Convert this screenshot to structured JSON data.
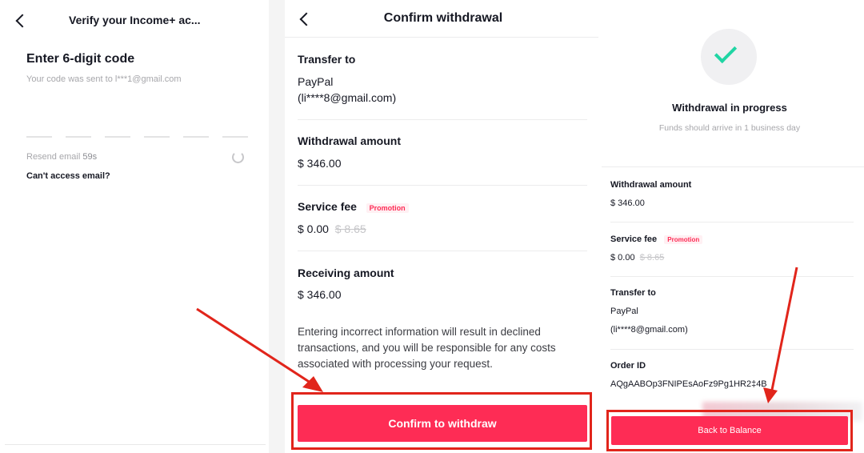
{
  "screen1": {
    "title": "Verify your Income+ ac...",
    "heading": "Enter 6-digit code",
    "subtext": "Your code was sent to l***1@gmail.com",
    "resend_label": "Resend email",
    "resend_timer": "59s",
    "cant_access": "Can't access email?"
  },
  "screen2": {
    "title": "Confirm withdrawal",
    "transfer_label": "Transfer to",
    "transfer_method": "PayPal",
    "transfer_email": "(li****8@gmail.com)",
    "withdrawal_label": "Withdrawal amount",
    "withdrawal_value": "$ 346.00",
    "fee_label": "Service fee",
    "promo_badge": "Promotion",
    "fee_value": "$ 0.00",
    "fee_original": "$ 8.65",
    "receiving_label": "Receiving amount",
    "receiving_value": "$ 346.00",
    "note": "Entering incorrect information will result in declined transactions, and you will be responsible for any costs associated with processing your request.",
    "confirm_button": "Confirm to withdraw"
  },
  "screen3": {
    "status_title": "Withdrawal in progress",
    "status_sub": "Funds should arrive in 1 business day",
    "withdrawal_label": "Withdrawal amount",
    "withdrawal_value": "$ 346.00",
    "fee_label": "Service fee",
    "promo_badge": "Promotion",
    "fee_value": "$ 0.00",
    "fee_original": "$ 8.65",
    "transfer_label": "Transfer to",
    "transfer_method": "PayPal",
    "transfer_email": "(li****8@gmail.com)",
    "order_label": "Order ID",
    "order_value": "AQgAABOp3FNIPEsAoFz9Pg1HR2‡4B",
    "back_button": "Back to Balance"
  },
  "colors": {
    "accent": "#fe2c55",
    "success": "#20d5a4",
    "annotation": "#e1251b"
  }
}
